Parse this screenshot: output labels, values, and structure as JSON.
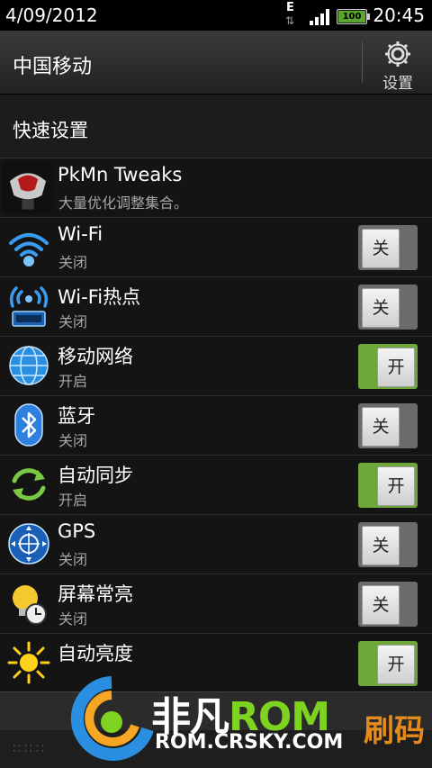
{
  "status_bar": {
    "date": "4/09/2012",
    "network_type": "E",
    "battery_level": "100",
    "time": "20:45"
  },
  "header": {
    "carrier": "中国移动",
    "settings_label": "设置"
  },
  "section": {
    "title": "快速设置"
  },
  "items": [
    {
      "name": "PkMn Tweaks",
      "sub": "大量优化调整集合。",
      "icon": "pkmn-tweaks-icon"
    },
    {
      "name": "Wi-Fi",
      "sub": "关闭",
      "toggle": "关",
      "on": false,
      "icon": "wifi-icon"
    },
    {
      "name": "Wi-Fi热点",
      "sub": "关闭",
      "toggle": "关",
      "on": false,
      "icon": "wifi-hotspot-icon"
    },
    {
      "name": "移动网络",
      "sub": "开启",
      "toggle": "开",
      "on": true,
      "icon": "globe-icon"
    },
    {
      "name": "蓝牙",
      "sub": "关闭",
      "toggle": "关",
      "on": false,
      "icon": "bluetooth-icon"
    },
    {
      "name": "自动同步",
      "sub": "开启",
      "toggle": "开",
      "on": true,
      "icon": "sync-icon"
    },
    {
      "name": "GPS",
      "sub": "关闭",
      "toggle": "关",
      "on": false,
      "icon": "gps-icon"
    },
    {
      "name": "屏幕常亮",
      "sub": "关闭",
      "toggle": "关",
      "on": false,
      "icon": "bulb-timer-icon"
    },
    {
      "name": "自动亮度",
      "sub": "",
      "toggle": "开",
      "on": true,
      "icon": "sun-icon"
    }
  ],
  "watermark": {
    "brand_a": "非凡",
    "brand_b": "ROM",
    "url": "ROM.CRSKY.COM",
    "right": "刷码"
  }
}
